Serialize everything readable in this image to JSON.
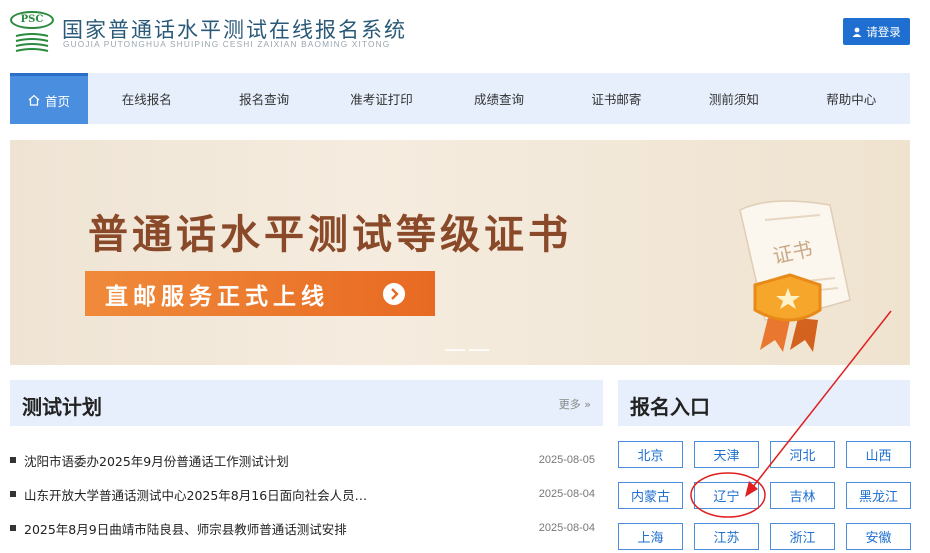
{
  "header": {
    "logo_text": "PSC",
    "title": "国家普通话水平测试在线报名系统",
    "subtitle": "GUOJIA PUTONGHUA SHUIPING CESHI ZAIXIAN BAOMING XITONG",
    "login_label": "请登录"
  },
  "nav": {
    "home": "首页",
    "items": [
      "在线报名",
      "报名查询",
      "准考证打印",
      "成绩查询",
      "证书邮寄",
      "测前须知",
      "帮助中心"
    ]
  },
  "banner": {
    "title": "普通话水平测试等级证书",
    "cta": "直邮服务正式上线",
    "cert_text": "证书"
  },
  "plan": {
    "title": "测试计划",
    "more": "更多 »",
    "items": [
      {
        "title": "沈阳市语委办2025年9月份普通话工作测试计划",
        "date": "2025-08-05"
      },
      {
        "title": "山东开放大学普通话测试中心2025年8月16日面向社会人员…",
        "date": "2025-08-04"
      },
      {
        "title": "2025年8月9日曲靖市陆良县、师宗县教师普通话测试安排",
        "date": "2025-08-04"
      }
    ]
  },
  "reg": {
    "title": "报名入口",
    "provinces": [
      "北京",
      "天津",
      "河北",
      "山西",
      "内蒙古",
      "辽宁",
      "吉林",
      "黑龙江",
      "上海",
      "江苏",
      "浙江",
      "安徽"
    ]
  },
  "colors": {
    "primary": "#1e6fd0",
    "nav_bg": "#e6effb",
    "annotation": "#e02020"
  }
}
